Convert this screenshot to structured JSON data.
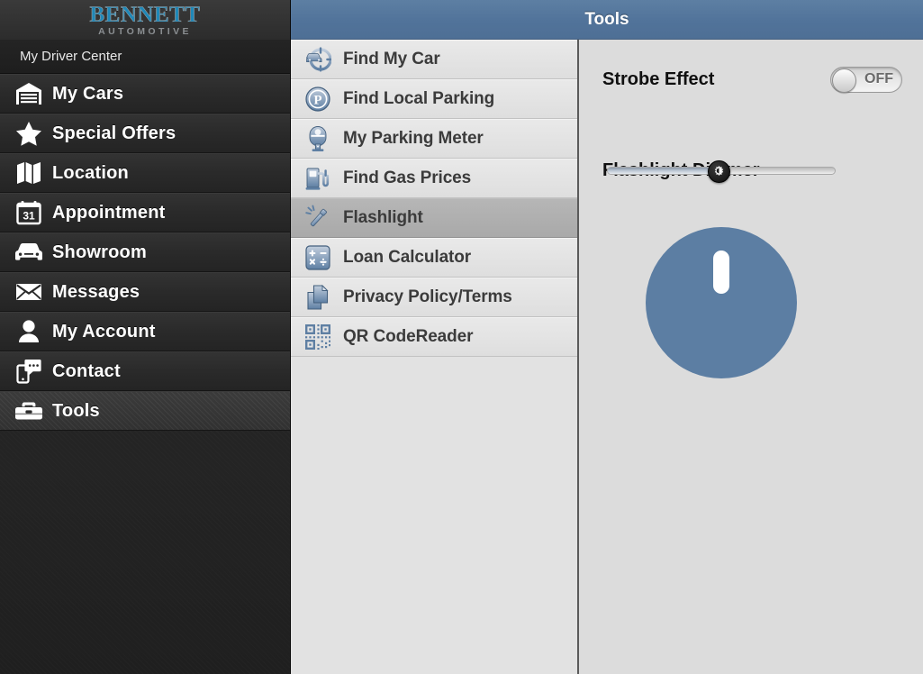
{
  "brand": {
    "name": "BENNETT",
    "tagline": "AUTOMOTIVE",
    "logo_color": "#1f88b8",
    "tagline_color": "#8b8f92"
  },
  "sidebar": {
    "section_label": "My Driver Center",
    "items": [
      {
        "label": "My Cars",
        "icon": "garage-icon",
        "active": false
      },
      {
        "label": "Special Offers",
        "icon": "star-icon",
        "active": false
      },
      {
        "label": "Location",
        "icon": "map-icon",
        "active": false
      },
      {
        "label": "Appointment",
        "icon": "calendar-icon",
        "active": false
      },
      {
        "label": "Showroom",
        "icon": "car-icon",
        "active": false
      },
      {
        "label": "Messages",
        "icon": "envelope-icon",
        "active": false
      },
      {
        "label": "My Account",
        "icon": "user-icon",
        "active": false
      },
      {
        "label": "Contact",
        "icon": "phone-chat-icon",
        "active": false
      },
      {
        "label": "Tools",
        "icon": "toolbox-icon",
        "active": true
      }
    ]
  },
  "header": {
    "title": "Tools",
    "background_color": "#51739a"
  },
  "tool_list": {
    "items": [
      {
        "label": "Find My Car",
        "icon": "car-locator-icon",
        "selected": false
      },
      {
        "label": "Find Local Parking",
        "icon": "parking-p-icon",
        "selected": false
      },
      {
        "label": "My Parking Meter",
        "icon": "parking-meter-icon",
        "selected": false
      },
      {
        "label": "Find Gas Prices",
        "icon": "gas-pump-icon",
        "selected": false
      },
      {
        "label": "Flashlight",
        "icon": "flashlight-icon",
        "selected": true
      },
      {
        "label": "Loan Calculator",
        "icon": "calculator-icon",
        "selected": false
      },
      {
        "label": "Privacy Policy/Terms",
        "icon": "documents-icon",
        "selected": false
      },
      {
        "label": "QR CodeReader",
        "icon": "qr-code-icon",
        "selected": false
      }
    ]
  },
  "detail": {
    "strobe_label": "Strobe Effect",
    "strobe_state": "OFF",
    "strobe_on": false,
    "dimmer_label": "Flashlight Dimmer",
    "dimmer_value_percent": 49,
    "power_button_color": "#5c7ea3"
  }
}
